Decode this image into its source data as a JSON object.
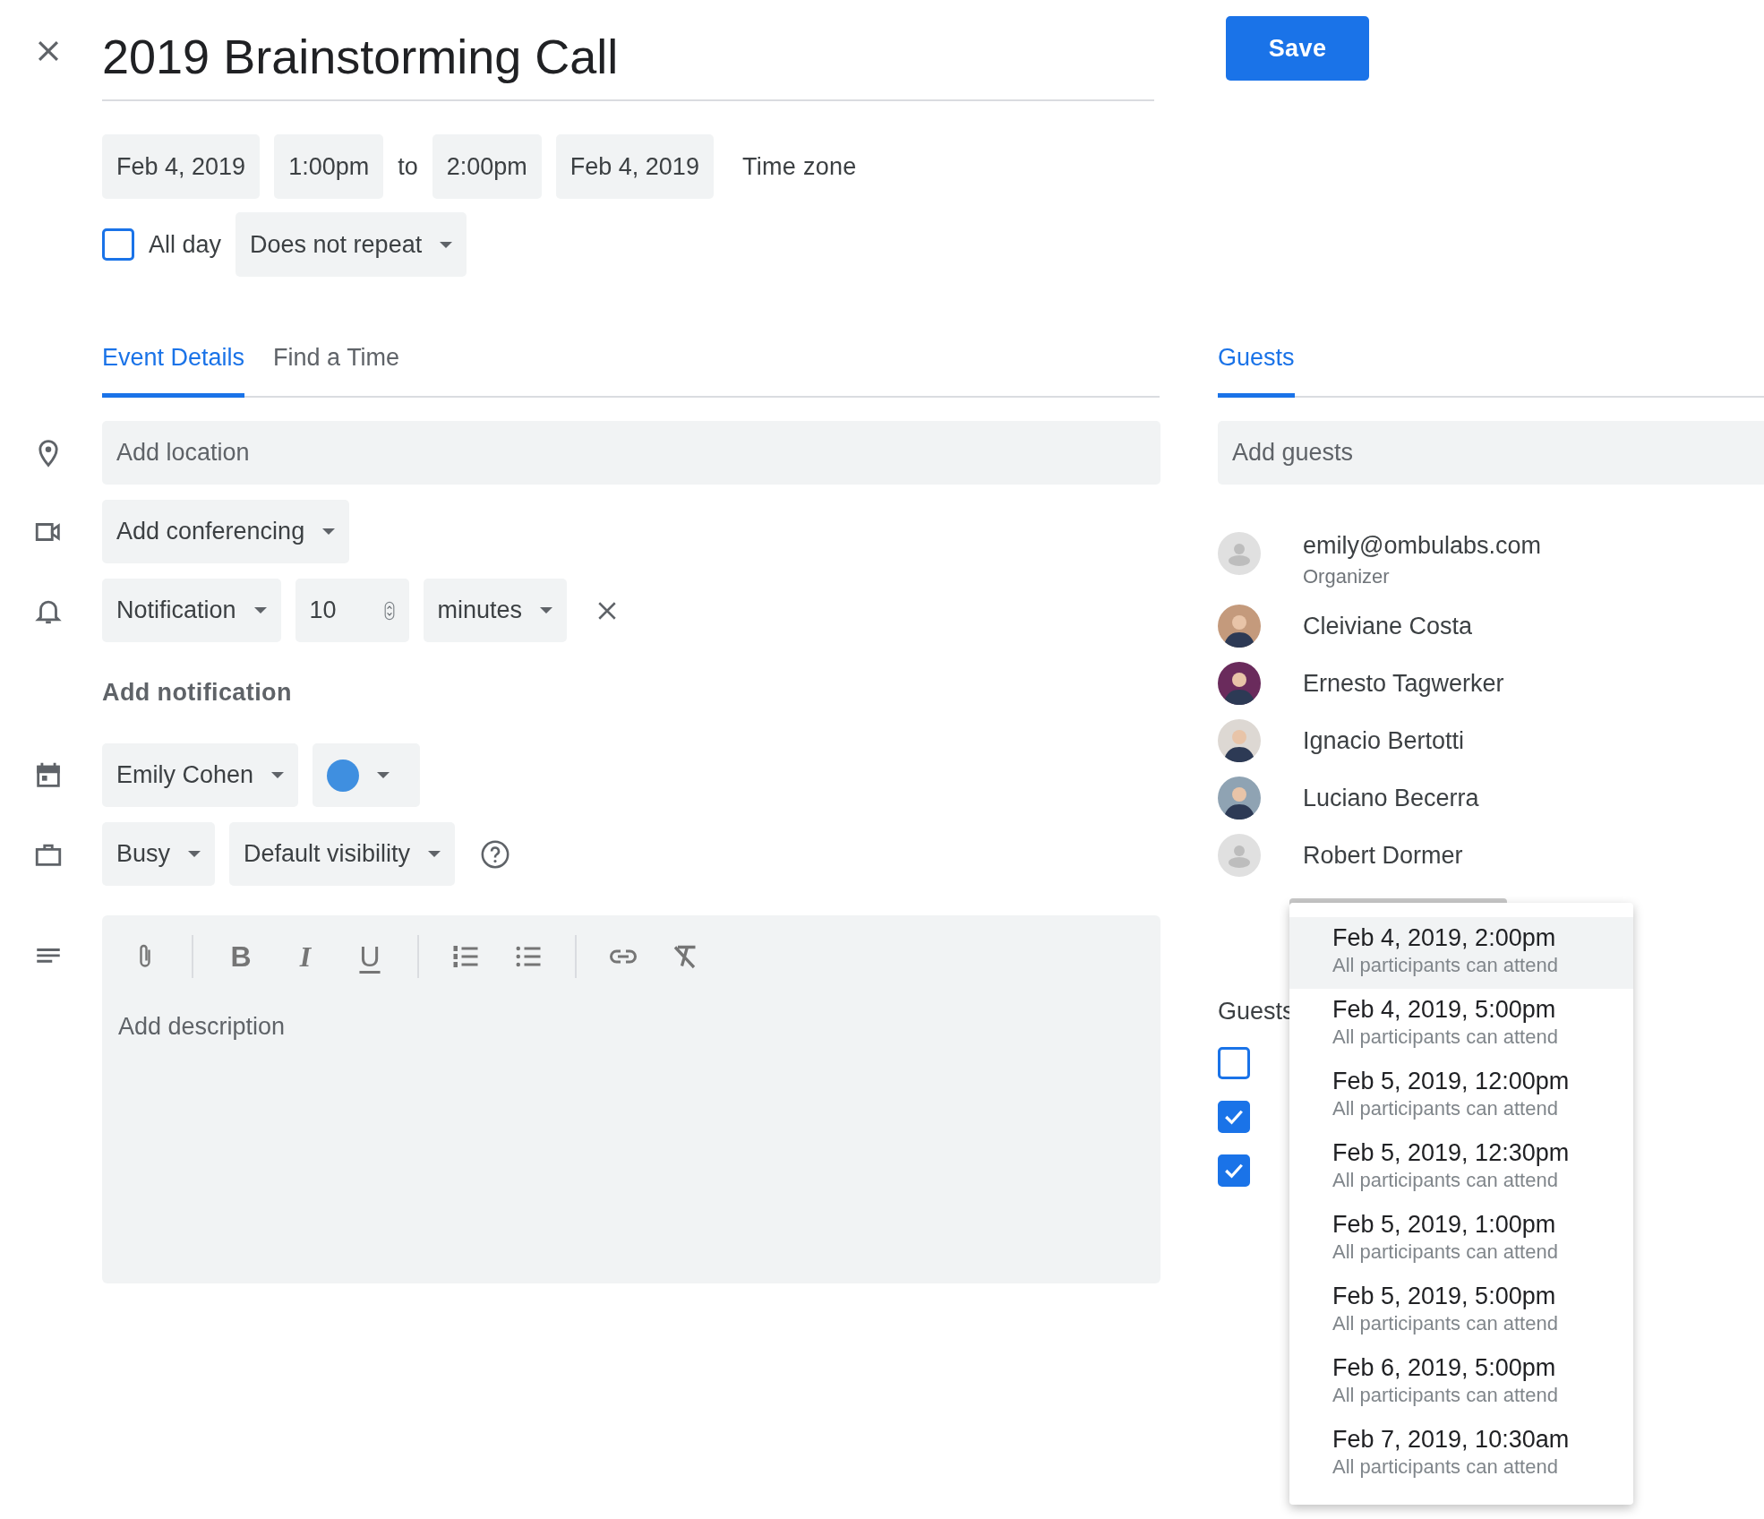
{
  "title": "2019 Brainstorming Call",
  "save_button": "Save",
  "date_time": {
    "start_date": "Feb 4, 2019",
    "start_time": "1:00pm",
    "separator": "to",
    "end_time": "2:00pm",
    "end_date": "Feb 4, 2019",
    "time_zone": "Time zone"
  },
  "all_day": {
    "label": "All day",
    "checked": false
  },
  "repeat": "Does not repeat",
  "tabs": [
    {
      "label": "Event Details",
      "selected": true
    },
    {
      "label": "Find a Time",
      "selected": false
    }
  ],
  "location": {
    "placeholder": "Add location"
  },
  "conferencing": "Add conferencing",
  "notification": {
    "type": "Notification",
    "amount": "10",
    "unit": "minutes"
  },
  "add_notification": "Add notification",
  "calendar": {
    "owner": "Emily Cohen",
    "color": "#3f8fe0"
  },
  "availability": "Busy",
  "visibility": "Default visibility",
  "description": {
    "placeholder": "Add description",
    "toolbar": [
      "B",
      "I",
      "U"
    ]
  },
  "guests_panel": {
    "tab": {
      "label": "Guests",
      "selected": true
    },
    "add_guests": {
      "placeholder": "Add guests"
    },
    "guests": [
      {
        "name": "emily@ombulabs.com",
        "role": "Organizer",
        "kind": "default"
      },
      {
        "name": "Cleiviane Costa",
        "kind": "photo",
        "color": "#c49a7c"
      },
      {
        "name": "Ernesto Tagwerker",
        "kind": "photo",
        "color": "#6a2b5c"
      },
      {
        "name": "Ignacio Bertotti",
        "kind": "photo",
        "color": "#ddd8d3"
      },
      {
        "name": "Luciano Becerra",
        "kind": "photo",
        "color": "#8fa3b3"
      },
      {
        "name": "Robert Dormer",
        "kind": "default"
      }
    ],
    "permissions": {
      "heading": "Guests",
      "options": [
        {
          "checked": false
        },
        {
          "checked": true
        },
        {
          "checked": true
        }
      ]
    }
  },
  "time_suggestions": [
    {
      "time": "Feb 4, 2019, 2:00pm",
      "note": "All participants can attend",
      "selected": true
    },
    {
      "time": "Feb 4, 2019, 5:00pm",
      "note": "All participants can attend",
      "selected": false
    },
    {
      "time": "Feb 5, 2019, 12:00pm",
      "note": "All participants can attend",
      "selected": false
    },
    {
      "time": "Feb 5, 2019, 12:30pm",
      "note": "All participants can attend",
      "selected": false
    },
    {
      "time": "Feb 5, 2019, 1:00pm",
      "note": "All participants can attend",
      "selected": false
    },
    {
      "time": "Feb 5, 2019, 5:00pm",
      "note": "All participants can attend",
      "selected": false
    },
    {
      "time": "Feb 6, 2019, 5:00pm",
      "note": "All participants can attend",
      "selected": false
    },
    {
      "time": "Feb 7, 2019, 10:30am",
      "note": "All participants can attend",
      "selected": false
    }
  ]
}
